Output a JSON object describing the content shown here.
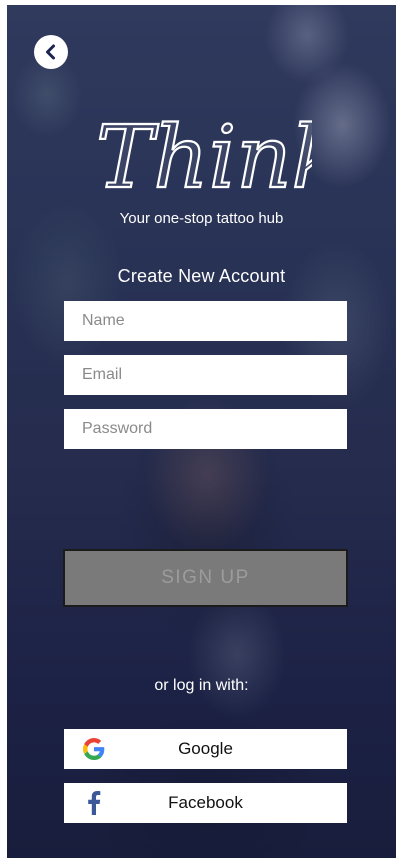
{
  "header": {
    "back_icon": "chevron-left-icon"
  },
  "brand": {
    "logo_text": "Think",
    "tagline": "Your one-stop tattoo hub"
  },
  "form": {
    "heading": "Create New Account",
    "name_placeholder": "Name",
    "email_placeholder": "Email",
    "password_placeholder": "Password",
    "signup_label": "SIGN UP"
  },
  "social": {
    "prompt": "or log in with:",
    "google_label": "Google",
    "facebook_label": "Facebook",
    "google_icon": "google-icon",
    "facebook_icon": "facebook-icon"
  },
  "colors": {
    "signup_bg": "#7a7a7a",
    "signup_text": "#9c9c9c",
    "facebook_blue": "#3b5998",
    "overlay": "#1e2450"
  }
}
